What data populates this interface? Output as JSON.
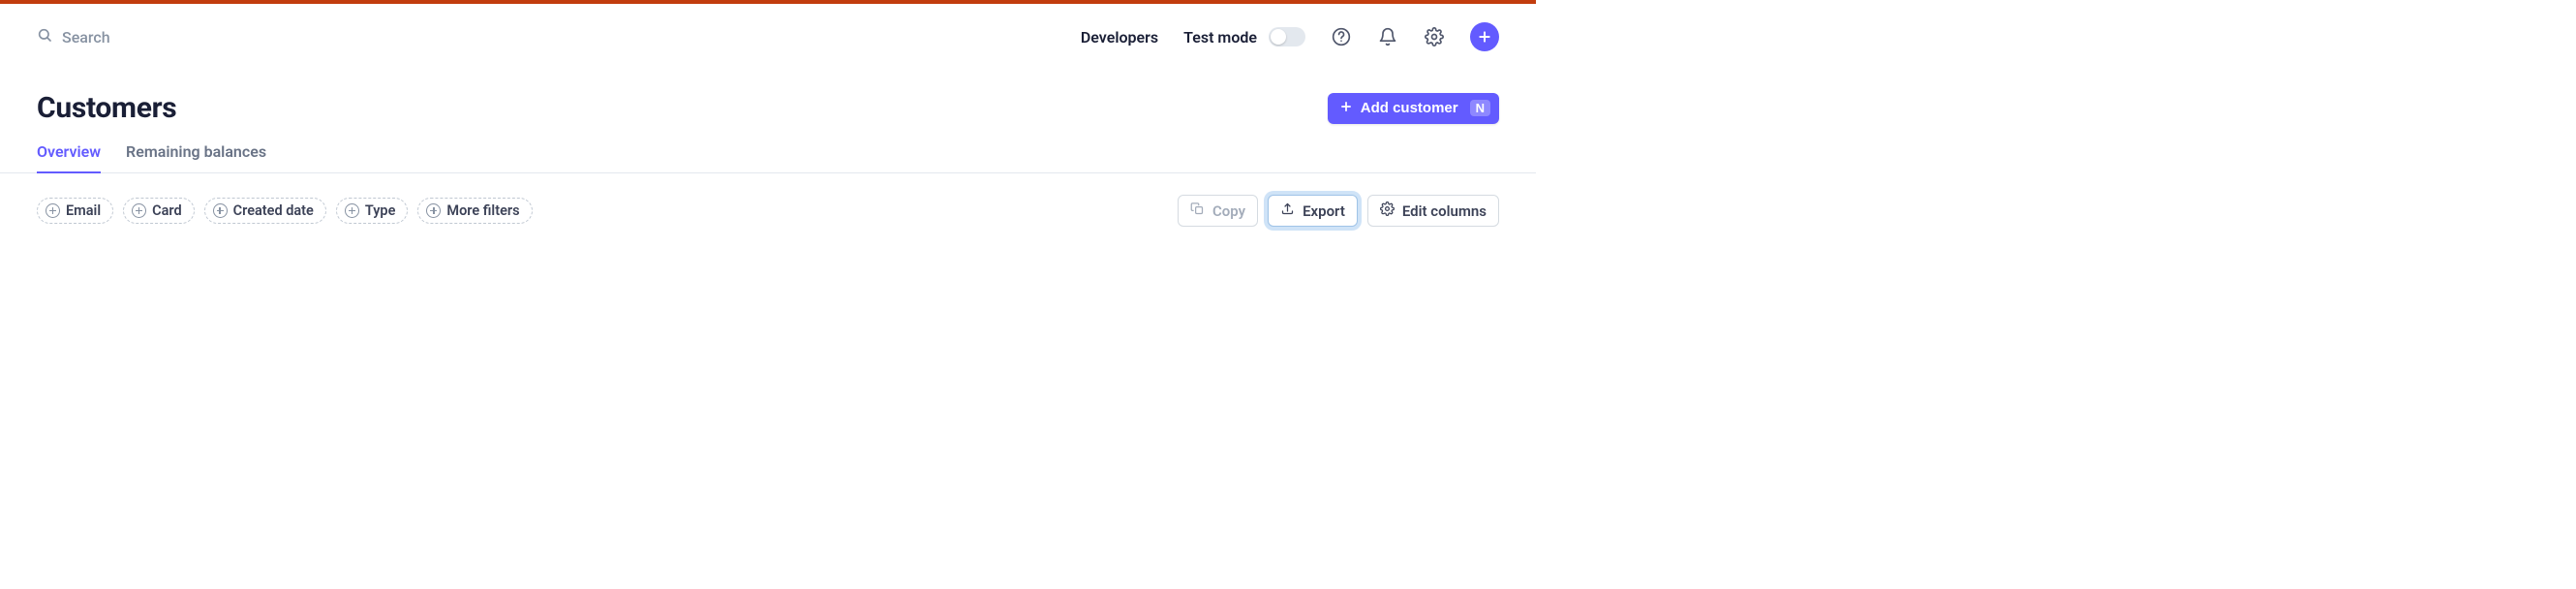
{
  "header": {
    "search_placeholder": "Search",
    "developers_label": "Developers",
    "test_mode_label": "Test mode",
    "test_mode_on": false
  },
  "page": {
    "title": "Customers",
    "add_button_label": "Add customer",
    "add_button_shortcut": "N"
  },
  "tabs": [
    {
      "label": "Overview",
      "active": true
    },
    {
      "label": "Remaining balances",
      "active": false
    }
  ],
  "filters": [
    {
      "label": "Email"
    },
    {
      "label": "Card"
    },
    {
      "label": "Created date"
    },
    {
      "label": "Type"
    },
    {
      "label": "More filters"
    }
  ],
  "toolbar": {
    "copy_label": "Copy",
    "copy_enabled": false,
    "export_label": "Export",
    "export_focused": true,
    "edit_columns_label": "Edit columns"
  }
}
